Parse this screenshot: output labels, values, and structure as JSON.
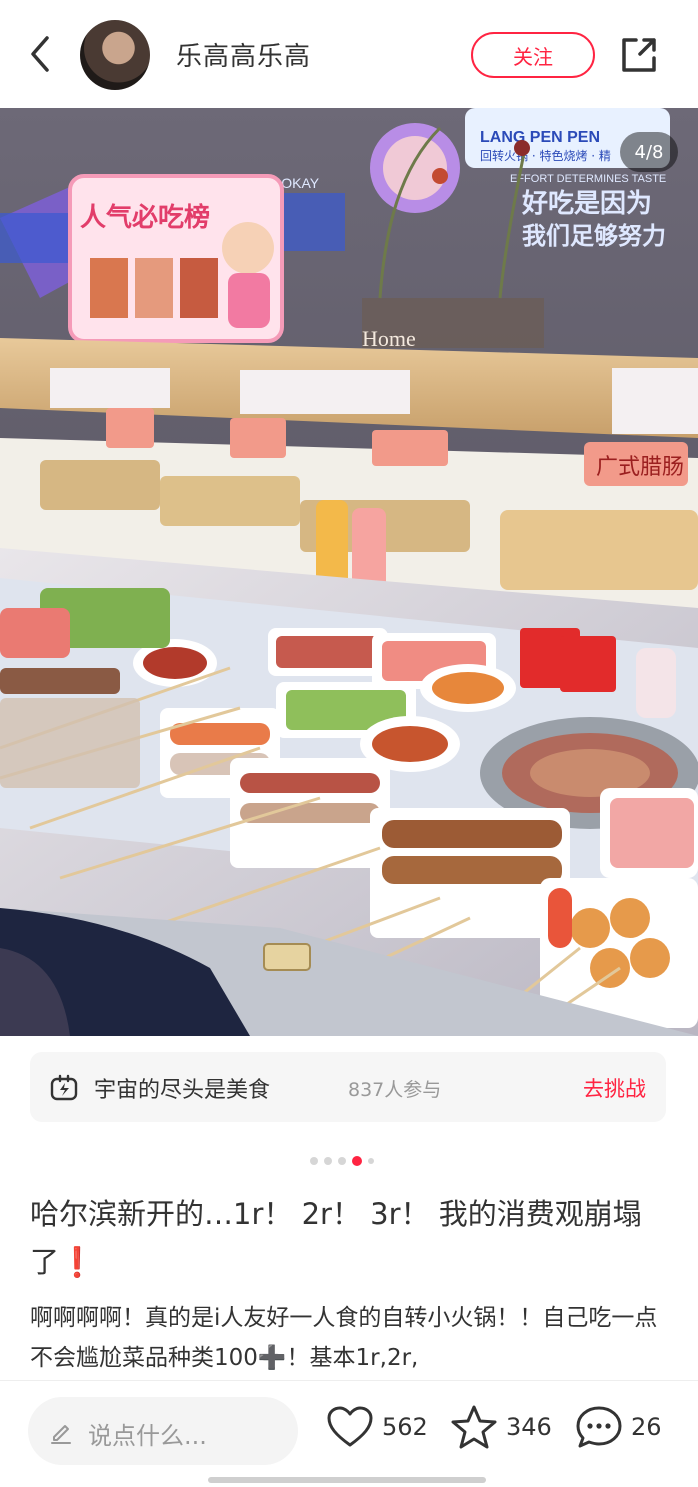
{
  "header": {
    "username": "乐高高乐高",
    "follow_label": "关注"
  },
  "photo": {
    "counter": "4/8",
    "signs": {
      "lang_pen": "LANG PEN PEN",
      "lang_pen_sub": "回转火锅 · 特色烧烤 · 精",
      "effort": "EFFORT DETERMINES TASTE",
      "tasty1": "好吃是因为",
      "tasty2": "我们足够努力",
      "its_okay": "S OKAY",
      "rank_title": "人气必吃榜",
      "cantonese": "广式腊肠",
      "home": "Home"
    }
  },
  "challenge": {
    "title": "宇宙的尽头是美食",
    "participants": "837人参与",
    "action": "去挑战"
  },
  "post": {
    "title": "哈尔滨新开的…1r！ 2r！ 3r！ 我的消费观崩塌了",
    "title_mark": "❗",
    "body": "啊啊啊啊！真的是i人友好一人食的自转小火锅！！自己吃一点不会尴尬菜品种类100➕！基本1r,2r,"
  },
  "bottom_bar": {
    "comment_placeholder": "说点什么...",
    "likes": "562",
    "stars": "346",
    "comments": "26"
  },
  "colors": {
    "accent": "#ff2442"
  }
}
